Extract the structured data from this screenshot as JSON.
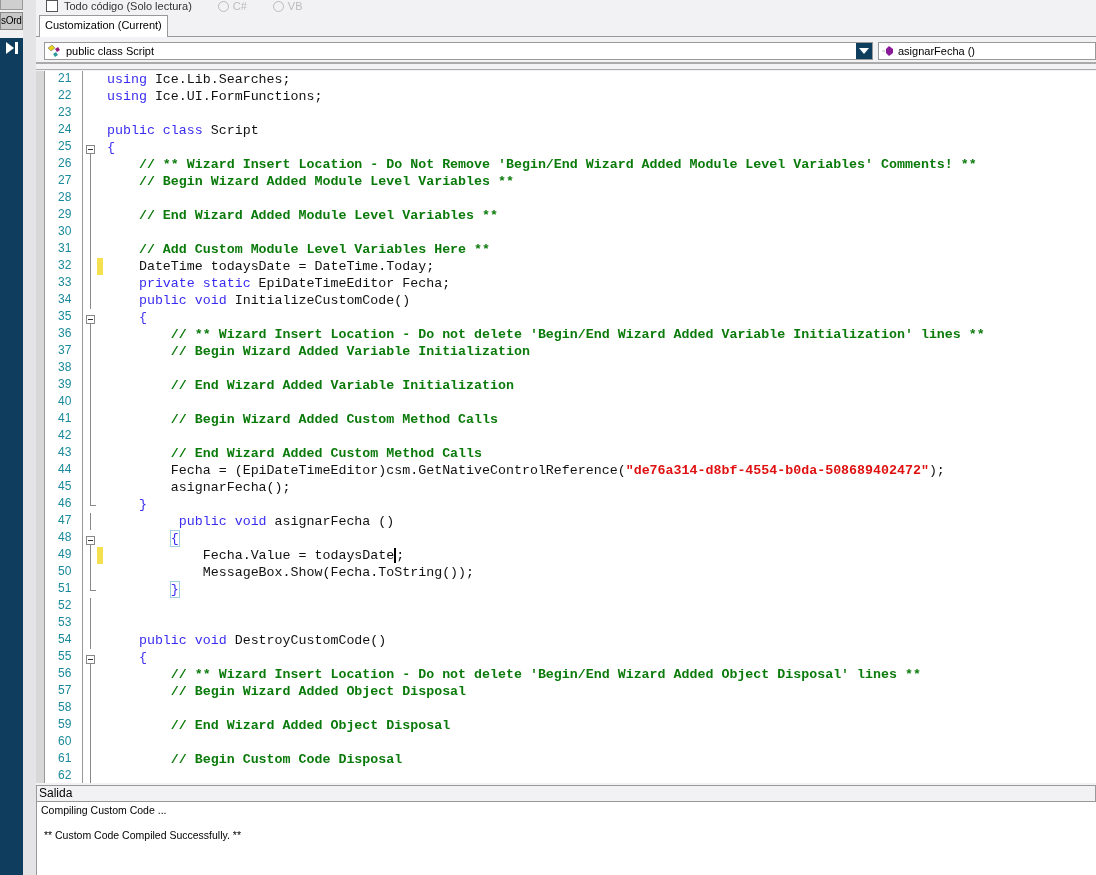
{
  "top_bar": {
    "checkbox": {
      "label": "Todo código (Solo lectura)",
      "checked": false
    },
    "radios": [
      {
        "label": "C#",
        "selected": false
      },
      {
        "label": "VB",
        "selected": false
      }
    ]
  },
  "side_rail": {
    "button": "sOrd"
  },
  "tabs": [
    {
      "label": "Customization (Current)",
      "selected": true
    }
  ],
  "class_dropdown": {
    "value": "public class Script"
  },
  "member_dropdown": {
    "value": "asignarFecha ()"
  },
  "editor": {
    "lines": [
      {
        "number": "21",
        "kind": "plain",
        "modified": false,
        "tokens": [
          {
            "kind": "keyword",
            "text": "using"
          },
          {
            "kind": "plain",
            "text": " Ice.Lib.Searches;"
          }
        ]
      },
      {
        "number": "22",
        "kind": "plain",
        "modified": false,
        "tokens": [
          {
            "kind": "keyword",
            "text": "using"
          },
          {
            "kind": "plain",
            "text": " Ice.UI.FormFunctions;"
          }
        ]
      },
      {
        "number": "23",
        "kind": "plain",
        "modified": false
      },
      {
        "number": "24",
        "kind": "plain",
        "modified": false,
        "tokens": [
          {
            "kind": "keyword",
            "text": "public class"
          },
          {
            "kind": "plain",
            "text": " Script"
          }
        ]
      },
      {
        "number": "25",
        "kind": "fold-start",
        "expanded": true,
        "modified": false,
        "tokens": [
          {
            "kind": "brace",
            "text": "{",
            "matched": false
          }
        ]
      },
      {
        "number": "26",
        "kind": "fold-line",
        "modified": false,
        "tokens": [
          {
            "kind": "comment",
            "text": "    // ** Wizard Insert Location - Do Not Remove 'Begin/End Wizard Added Module Level Variables' Comments! **"
          }
        ]
      },
      {
        "number": "27",
        "kind": "fold-line",
        "modified": false,
        "tokens": [
          {
            "kind": "comment",
            "text": "    // Begin Wizard Added Module Level Variables **"
          }
        ]
      },
      {
        "number": "28",
        "kind": "fold-line",
        "modified": false
      },
      {
        "number": "29",
        "kind": "fold-line",
        "modified": false,
        "tokens": [
          {
            "kind": "comment",
            "text": "    // End Wizard Added Module Level Variables **"
          }
        ]
      },
      {
        "number": "30",
        "kind": "fold-line",
        "modified": false
      },
      {
        "number": "31",
        "kind": "fold-line",
        "modified": false,
        "tokens": [
          {
            "kind": "comment",
            "text": "    // Add Custom Module Level Variables Here **"
          }
        ]
      },
      {
        "number": "32",
        "kind": "fold-line",
        "modified": true,
        "tokens": [
          {
            "kind": "plain",
            "text": "    DateTime todaysDate = DateTime.Today;"
          }
        ]
      },
      {
        "number": "33",
        "kind": "fold-line",
        "modified": false,
        "tokens": [
          {
            "kind": "keyword",
            "text": "    private static"
          },
          {
            "kind": "plain",
            "text": " EpiDateTimeEditor Fecha;"
          }
        ]
      },
      {
        "number": "34",
        "kind": "fold-line",
        "modified": false,
        "tokens": [
          {
            "kind": "keyword",
            "text": "    public void"
          },
          {
            "kind": "plain",
            "text": " InitializeCustomCode()"
          }
        ]
      },
      {
        "number": "35",
        "kind": "fold-start",
        "expanded": true,
        "modified": false,
        "tokens": [
          {
            "kind": "brace",
            "text": "    {",
            "matched": false
          }
        ]
      },
      {
        "number": "36",
        "kind": "fold-line",
        "modified": false,
        "tokens": [
          {
            "kind": "comment",
            "text": "        // ** Wizard Insert Location - Do not delete 'Begin/End Wizard Added Variable Initialization' lines **"
          }
        ]
      },
      {
        "number": "37",
        "kind": "fold-line",
        "modified": false,
        "tokens": [
          {
            "kind": "comment",
            "text": "        // Begin Wizard Added Variable Initialization"
          }
        ]
      },
      {
        "number": "38",
        "kind": "fold-line",
        "modified": false
      },
      {
        "number": "39",
        "kind": "fold-line",
        "modified": false,
        "tokens": [
          {
            "kind": "comment",
            "text": "        // End Wizard Added Variable Initialization"
          }
        ]
      },
      {
        "number": "40",
        "kind": "fold-line",
        "modified": false
      },
      {
        "number": "41",
        "kind": "fold-line",
        "modified": false,
        "tokens": [
          {
            "kind": "comment",
            "text": "        // Begin Wizard Added Custom Method Calls"
          }
        ]
      },
      {
        "number": "42",
        "kind": "fold-line",
        "modified": false
      },
      {
        "number": "43",
        "kind": "fold-line",
        "modified": false,
        "tokens": [
          {
            "kind": "comment",
            "text": "        // End Wizard Added Custom Method Calls"
          }
        ]
      },
      {
        "number": "44",
        "kind": "fold-line",
        "modified": false,
        "tokens": [
          {
            "kind": "plain",
            "text": "        Fecha = (EpiDateTimeEditor)csm.GetNativeControlReference("
          },
          {
            "kind": "string",
            "text": "\"de76a314-d8bf-4554-b0da-508689402472\""
          },
          {
            "kind": "plain",
            "text": ");"
          }
        ]
      },
      {
        "number": "45",
        "kind": "fold-line",
        "modified": false,
        "tokens": [
          {
            "kind": "plain",
            "text": "        asignarFecha();"
          }
        ]
      },
      {
        "number": "46",
        "kind": "fold-end",
        "modified": false,
        "tokens": [
          {
            "kind": "brace",
            "text": "    }",
            "matched": false
          }
        ]
      },
      {
        "number": "47",
        "kind": "fold-line",
        "modified": false,
        "tokens": [
          {
            "kind": "keyword",
            "text": "         public void"
          },
          {
            "kind": "plain",
            "text": " asignarFecha ()"
          }
        ]
      },
      {
        "number": "48",
        "kind": "fold-start",
        "expanded": true,
        "modified": false,
        "tokens": [
          {
            "kind": "brace",
            "text": "        {",
            "matched": true
          }
        ]
      },
      {
        "number": "49",
        "kind": "fold-line",
        "modified": true,
        "tokens": [
          {
            "kind": "plain",
            "text": "            Fecha.Value = todaysDate"
          },
          {
            "kind": "cursor",
            "text": ";"
          }
        ]
      },
      {
        "number": "50",
        "kind": "fold-line",
        "modified": false,
        "tokens": [
          {
            "kind": "plain",
            "text": "            MessageBox.Show(Fecha.ToString());"
          }
        ]
      },
      {
        "number": "51",
        "kind": "fold-end",
        "modified": false,
        "tokens": [
          {
            "kind": "brace",
            "text": "        }",
            "matched": true
          }
        ]
      },
      {
        "number": "52",
        "kind": "fold-line",
        "modified": false
      },
      {
        "number": "53",
        "kind": "fold-line",
        "modified": false
      },
      {
        "number": "54",
        "kind": "fold-line",
        "modified": false,
        "tokens": [
          {
            "kind": "keyword",
            "text": "    public void"
          },
          {
            "kind": "plain",
            "text": " DestroyCustomCode()"
          }
        ]
      },
      {
        "number": "55",
        "kind": "fold-start",
        "expanded": true,
        "modified": false,
        "tokens": [
          {
            "kind": "brace",
            "text": "    {",
            "matched": false
          }
        ]
      },
      {
        "number": "56",
        "kind": "fold-line",
        "modified": false,
        "tokens": [
          {
            "kind": "comment",
            "text": "        // ** Wizard Insert Location - Do not delete 'Begin/End Wizard Added Object Disposal' lines **"
          }
        ]
      },
      {
        "number": "57",
        "kind": "fold-line",
        "modified": false,
        "tokens": [
          {
            "kind": "comment",
            "text": "        // Begin Wizard Added Object Disposal"
          }
        ]
      },
      {
        "number": "58",
        "kind": "fold-line",
        "modified": false
      },
      {
        "number": "59",
        "kind": "fold-line",
        "modified": false,
        "tokens": [
          {
            "kind": "comment",
            "text": "        // End Wizard Added Object Disposal"
          }
        ]
      },
      {
        "number": "60",
        "kind": "fold-line",
        "modified": false
      },
      {
        "number": "61",
        "kind": "fold-line",
        "modified": false,
        "tokens": [
          {
            "kind": "comment",
            "text": "        // Begin Custom Code Disposal"
          }
        ]
      },
      {
        "number": "62",
        "kind": "fold-line",
        "modified": false
      }
    ]
  },
  "output": {
    "title": "Salida",
    "lines": [
      "Compiling Custom Code ...",
      " ** Custom Code Compiled Successfully. **"
    ]
  }
}
